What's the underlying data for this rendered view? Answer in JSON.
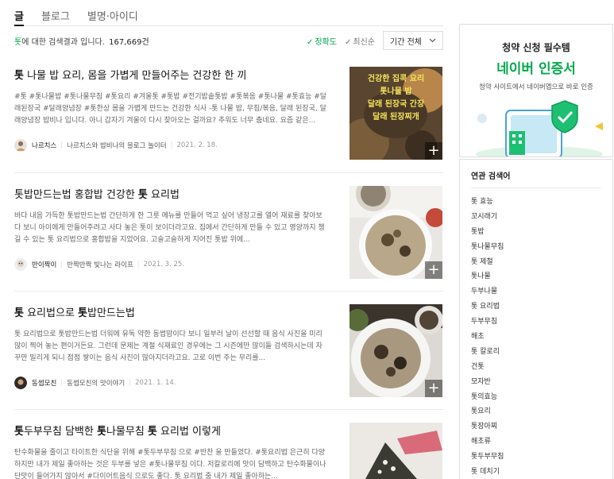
{
  "tabs": [
    {
      "label": "글"
    },
    {
      "label": "블로그"
    },
    {
      "label": "별명·아이디"
    }
  ],
  "result_summary": {
    "keyword": "톳",
    "text": "에 대한 검색결과 입니다.",
    "count": "167,669건"
  },
  "sort": {
    "accuracy": "정확도",
    "latest": "최신순",
    "period": "기간 전체"
  },
  "posts": [
    {
      "title_parts": [
        {
          "b": true,
          "t": "톳"
        },
        {
          "b": false,
          "t": " 나물 밥 요리, 몸을 가볍게 만들어주는 건강한 한 끼"
        }
      ],
      "body": "#톳 #톳나물밥 #톳나물무침 #톳요리 #겨울톳 #톳밥 #전기밥솥톳밥 #톳볶음 #톳나물 #톳효능 #달래된장국 #달래양념장 #톳한상 몸을 가볍게 만드는 건강한 식사 -톳 나물 밥, 무침/볶음, 달래 된장국, 달래양념장 밥비나 입니다. 아니 갑자기 겨울이 다시 찾아오는 걸까요? 추워도 너무 춥네요. 요즘 같은...",
      "author": "나르치스",
      "blog": "나르치스와 밥비나의 블로그 놀이터",
      "date": "2021. 2. 18.",
      "thumb_text": "건강한 집콕 요리\n톳나물 밥\n달래 된장국 간장\n달래 된장찌개"
    },
    {
      "title_parts": [
        {
          "b": false,
          "t": "톳밥만드는법 홍합밥 건강한 "
        },
        {
          "b": true,
          "t": "톳"
        },
        {
          "b": false,
          "t": " 요리법"
        }
      ],
      "body": "바다 내음 가득한 톳밥만드는법 간단하게 한 그릇 메뉴를 만들어 먹고 싶어 냉장고를 열어 재료를 찾아보다 보니 아이에게 만들어주려고 사다 놓은 톳이 보이더라고요. 집에서 간단하게 만들 수 있고 영양까지 챙길 수 있는 톳 요리법으로 홍합밥을 지었어요. 고슬고슬하게 지어진 톳밥 위에...",
      "author": "반이짝이",
      "blog": "반짝반짝 빛나는 라이프",
      "date": "2021. 3. 25."
    },
    {
      "title_parts": [
        {
          "b": true,
          "t": "톳"
        },
        {
          "b": false,
          "t": " 요리법으로 "
        },
        {
          "b": true,
          "t": "톳"
        },
        {
          "b": false,
          "t": "밥만드는법"
        }
      ],
      "body": "톳 요리법으로 톳밥만드는법 더워에 유독 약한 동썹맘이다 보니 일부러 날이 선선할 때 음식 사진을 미리 많이 찍어 놓는 편이거든요. 그런데 문제는 계절 식재료인 경우에는 그 시즌에만 많이들 검색하시는데 자꾸만 밀리게 되니 점점 쌓이는 음식 사진이 많아지더라고요. 고로 이번 주는 무리를...",
      "author": "동썹모친",
      "blog": "동썹모친의 맛이야기",
      "date": "2021. 1. 14."
    },
    {
      "title_parts": [
        {
          "b": true,
          "t": "톳"
        },
        {
          "b": false,
          "t": "두부무침 담백한 "
        },
        {
          "b": true,
          "t": "톳"
        },
        {
          "b": false,
          "t": "나물무침 "
        },
        {
          "b": true,
          "t": "톳"
        },
        {
          "b": false,
          "t": " 요리법 이렇게"
        }
      ],
      "body": "탄수화물을 줄이고 타이트한 식단을 위해 #톳두부무침 으로 #반찬 을 만들었다. #톳요리법 은근히 다양하지만 내가 제일 좋아하는 것은 두부를 넣은 #톳나물무침 이다. 저칼로리에 맛이 담백하고 탄수화물이나 단맛이 들어가지 않아서 #다이어트음식 으로도 좋다. 톳 요리법 중 내가 제일 좋아하는..."
    }
  ],
  "ad": {
    "title": "청약 신청 필수템",
    "big": "네이버 인증서",
    "sub": "청약 사이트에서 네이버앱으로 바로 인증"
  },
  "related": {
    "heading": "연관 검색어",
    "items": [
      "톳 효능",
      "꼬시래기",
      "톳밥",
      "톳나물무침",
      "톳 제철",
      "톳나물",
      "두부나물",
      "톳 요리법",
      "두부무침",
      "해초",
      "톳 칼로리",
      "건톳",
      "모자반",
      "톳의효능",
      "톳요리",
      "톳장아찌",
      "해초류",
      "톳두부무침",
      "톳 데치기"
    ]
  },
  "colors": {
    "accent": "#03a94d",
    "text": "#222222",
    "muted": "#999999"
  }
}
